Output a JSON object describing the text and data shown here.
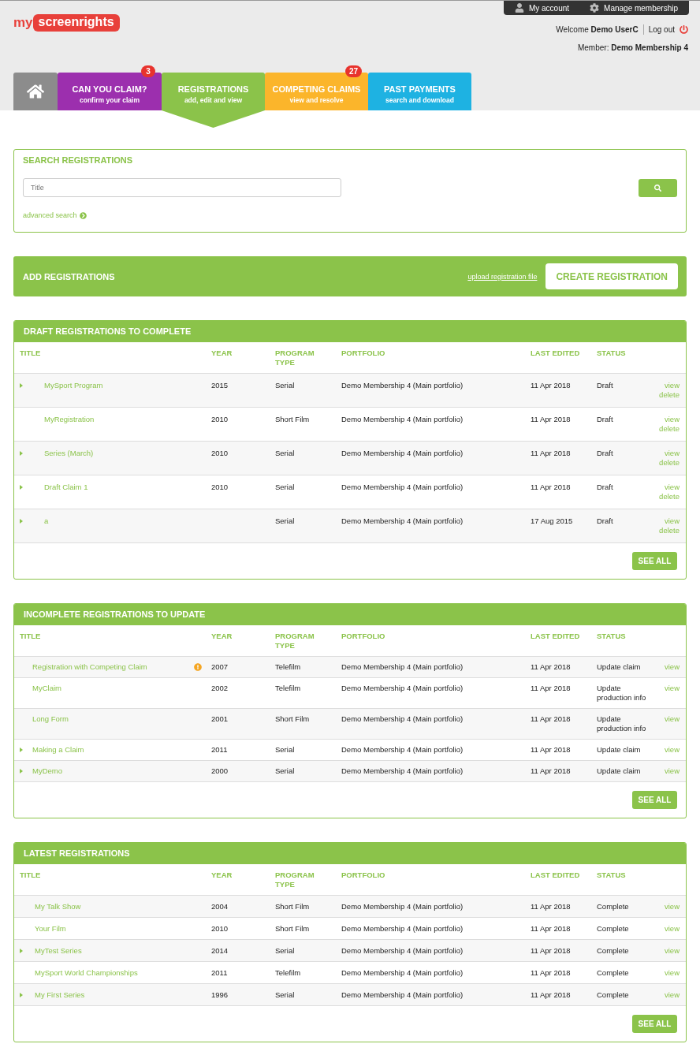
{
  "logo": {
    "prefix": "my",
    "name": "screenrights"
  },
  "account_bar": [
    {
      "kind": "account",
      "label": "My account"
    },
    {
      "kind": "settings",
      "label": "Manage membership"
    }
  ],
  "welcome": "Welcome **Demo UserC**",
  "logout": "Log out",
  "member": "Member: **Demo Membership 4**",
  "tabs": [
    {
      "kind": "home",
      "selected": false,
      "color": "#8c8c8c"
    },
    {
      "kind": "section",
      "title": "CAN YOU CLAIM?",
      "subtitle": "confirm your claim",
      "badge": "3",
      "selected": false,
      "color": "#9c2fae"
    },
    {
      "kind": "section",
      "title": "REGISTRATIONS",
      "subtitle": "add, edit and view",
      "selected": true,
      "color": "#8bc34a"
    },
    {
      "kind": "section",
      "title": "COMPETING CLAIMS",
      "subtitle": "view and resolve",
      "badge": "27",
      "selected": false,
      "color": "#fbb52b"
    },
    {
      "kind": "section",
      "title": "PAST PAYMENTS",
      "subtitle": "search and download",
      "selected": false,
      "color": "#1eb2e2"
    }
  ],
  "search": {
    "title": "SEARCH REGISTRATIONS",
    "placeholder": "Title",
    "advanced": "advanced search"
  },
  "add": {
    "title": "ADD REGISTRATIONS",
    "upload_link": "upload registration file",
    "create_button": "CREATE REGISTRATION"
  },
  "tables": [
    {
      "title": "DRAFT REGISTRATIONS TO COMPLETE",
      "columns": [
        "TITLE",
        "YEAR",
        "PROGRAM TYPE",
        "PORTFOLIO",
        "LAST EDITED",
        "STATUS"
      ],
      "see_all": "SEE ALL",
      "rows": [
        {
          "expandable": true,
          "warning": false,
          "title": "MySport Program",
          "year": "2015",
          "program_type": "Serial",
          "portfolio": "Demo Membership 4 (Main portfolio)",
          "last_edited": "11 Apr 2018",
          "status": "Draft",
          "actions": [
            "view",
            "delete"
          ]
        },
        {
          "expandable": false,
          "warning": false,
          "title": "MyRegistration",
          "year": "2010",
          "program_type": "Short Film",
          "portfolio": "Demo Membership 4 (Main portfolio)",
          "last_edited": "11 Apr 2018",
          "status": "Draft",
          "actions": [
            "view",
            "delete"
          ]
        },
        {
          "expandable": true,
          "warning": false,
          "title": "Series (March)",
          "year": "2010",
          "program_type": "Serial",
          "portfolio": "Demo Membership 4 (Main portfolio)",
          "last_edited": "11 Apr 2018",
          "status": "Draft",
          "actions": [
            "view",
            "delete"
          ]
        },
        {
          "expandable": true,
          "warning": false,
          "title": "Draft Claim 1",
          "year": "2010",
          "program_type": "Serial",
          "portfolio": "Demo Membership 4 (Main portfolio)",
          "last_edited": "11 Apr 2018",
          "status": "Draft",
          "actions": [
            "view",
            "delete"
          ]
        },
        {
          "expandable": true,
          "warning": false,
          "title": "a",
          "program_type": "Serial",
          "portfolio": "Demo Membership 4 (Main portfolio)",
          "last_edited": "17 Aug 2015",
          "status": "Draft",
          "actions": [
            "view",
            "delete"
          ]
        }
      ]
    },
    {
      "title": "INCOMPLETE REGISTRATIONS TO UPDATE",
      "columns": [
        "TITLE",
        "YEAR",
        "PROGRAM TYPE",
        "PORTFOLIO",
        "LAST EDITED",
        "STATUS"
      ],
      "see_all": "SEE ALL",
      "rows": [
        {
          "expandable": false,
          "warning": true,
          "title": "Registration with Competing Claim",
          "year": "2007",
          "program_type": "Telefilm",
          "portfolio": "Demo Membership 4 (Main portfolio)",
          "last_edited": "11 Apr 2018",
          "status": "Update claim",
          "actions": [
            "view"
          ]
        },
        {
          "expandable": false,
          "warning": false,
          "title": "MyClaim",
          "year": "2002",
          "program_type": "Telefilm",
          "portfolio": "Demo Membership 4 (Main portfolio)",
          "last_edited": "11 Apr 2018",
          "status": "Update production info",
          "actions": [
            "view"
          ]
        },
        {
          "expandable": false,
          "warning": false,
          "title": "Long Form",
          "year": "2001",
          "program_type": "Short Film",
          "portfolio": "Demo Membership 4 (Main portfolio)",
          "last_edited": "11 Apr 2018",
          "status": "Update production info",
          "actions": [
            "view"
          ]
        },
        {
          "expandable": true,
          "warning": false,
          "title": "Making a Claim",
          "year": "2011",
          "program_type": "Serial",
          "portfolio": "Demo Membership 4 (Main portfolio)",
          "last_edited": "11 Apr 2018",
          "status": "Update claim",
          "actions": [
            "view"
          ]
        },
        {
          "expandable": true,
          "warning": false,
          "title": "MyDemo",
          "year": "2000",
          "program_type": "Serial",
          "portfolio": "Demo Membership 4 (Main portfolio)",
          "last_edited": "11 Apr 2018",
          "status": "Update claim",
          "actions": [
            "view"
          ]
        }
      ]
    },
    {
      "title": "LATEST REGISTRATIONS",
      "columns": [
        "TITLE",
        "YEAR",
        "PROGRAM TYPE",
        "PORTFOLIO",
        "LAST EDITED",
        "STATUS"
      ],
      "see_all": "SEE ALL",
      "rows": [
        {
          "expandable": false,
          "warning": false,
          "title": "My Talk Show",
          "year": "2004",
          "program_type": "Short Film",
          "portfolio": "Demo Membership 4 (Main portfolio)",
          "last_edited": "11 Apr 2018",
          "status": "Complete",
          "actions": [
            "view"
          ]
        },
        {
          "expandable": false,
          "warning": false,
          "title": "Your Film",
          "year": "2010",
          "program_type": "Short Film",
          "portfolio": "Demo Membership 4 (Main portfolio)",
          "last_edited": "11 Apr 2018",
          "status": "Complete",
          "actions": [
            "view"
          ]
        },
        {
          "expandable": true,
          "warning": false,
          "title": "MyTest Series",
          "year": "2014",
          "program_type": "Serial",
          "portfolio": "Demo Membership 4 (Main portfolio)",
          "last_edited": "11 Apr 2018",
          "status": "Complete",
          "actions": [
            "view"
          ]
        },
        {
          "expandable": false,
          "warning": false,
          "title": "MySport World Championships",
          "year": "2011",
          "program_type": "Telefilm",
          "portfolio": "Demo Membership 4 (Main portfolio)",
          "last_edited": "11 Apr 2018",
          "status": "Complete",
          "actions": [
            "view"
          ]
        },
        {
          "expandable": true,
          "warning": false,
          "title": "My First Series",
          "year": "1996",
          "program_type": "Serial",
          "portfolio": "Demo Membership 4 (Main portfolio)",
          "last_edited": "11 Apr 2018",
          "status": "Complete",
          "actions": [
            "view"
          ]
        }
      ]
    }
  ]
}
